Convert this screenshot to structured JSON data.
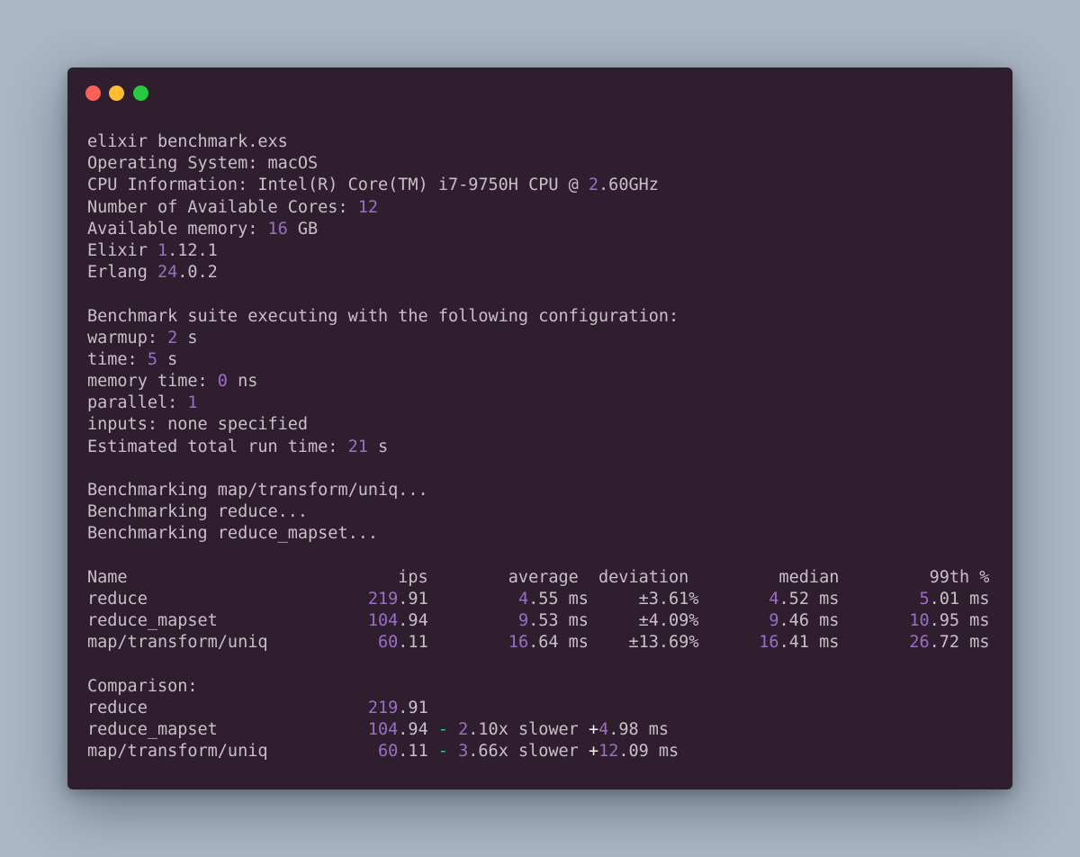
{
  "window": {
    "controls": [
      "close",
      "minimize",
      "zoom"
    ]
  },
  "colors": {
    "background": "#a9b6c3",
    "terminal_bg": "#2e1e2e",
    "text": "#c9bfc9",
    "number": "#9b6fc6",
    "separator": "#33c481",
    "plus": "#f2f2f2"
  },
  "terminal": {
    "lines": [
      [
        {
          "t": "elixir benchmark.exs"
        }
      ],
      [
        {
          "t": "Operating System: macOS"
        }
      ],
      [
        {
          "t": "CPU Information: Intel(R) Core(TM) i7-9750H CPU @ "
        },
        {
          "t": "2",
          "c": "n"
        },
        {
          "t": ".60GHz"
        }
      ],
      [
        {
          "t": "Number of Available Cores: "
        },
        {
          "t": "12",
          "c": "n"
        }
      ],
      [
        {
          "t": "Available memory: "
        },
        {
          "t": "16",
          "c": "n"
        },
        {
          "t": " GB"
        }
      ],
      [
        {
          "t": "Elixir "
        },
        {
          "t": "1",
          "c": "n"
        },
        {
          "t": ".12.1"
        }
      ],
      [
        {
          "t": "Erlang "
        },
        {
          "t": "24",
          "c": "n"
        },
        {
          "t": ".0.2"
        }
      ],
      [],
      [
        {
          "t": "Benchmark suite executing with the following configuration:"
        }
      ],
      [
        {
          "t": "warmup: "
        },
        {
          "t": "2",
          "c": "n"
        },
        {
          "t": " s"
        }
      ],
      [
        {
          "t": "time: "
        },
        {
          "t": "5",
          "c": "n"
        },
        {
          "t": " s"
        }
      ],
      [
        {
          "t": "memory time: "
        },
        {
          "t": "0",
          "c": "n"
        },
        {
          "t": " ns"
        }
      ],
      [
        {
          "t": "parallel: "
        },
        {
          "t": "1",
          "c": "n"
        }
      ],
      [
        {
          "t": "inputs: none specified"
        }
      ],
      [
        {
          "t": "Estimated total run time: "
        },
        {
          "t": "21",
          "c": "n"
        },
        {
          "t": " s"
        }
      ],
      [],
      [
        {
          "t": "Benchmarking map/transform/uniq..."
        }
      ],
      [
        {
          "t": "Benchmarking reduce..."
        }
      ],
      [
        {
          "t": "Benchmarking reduce_mapset..."
        }
      ],
      [],
      [
        {
          "t": "Name                           ips        average  deviation         median         99th %"
        }
      ],
      [
        {
          "t": "reduce                      "
        },
        {
          "t": "219",
          "c": "n"
        },
        {
          "t": ".91         "
        },
        {
          "t": "4",
          "c": "n"
        },
        {
          "t": ".55 ms     ±3.61%       "
        },
        {
          "t": "4",
          "c": "n"
        },
        {
          "t": ".52 ms        "
        },
        {
          "t": "5",
          "c": "n"
        },
        {
          "t": ".01 ms"
        }
      ],
      [
        {
          "t": "reduce_mapset               "
        },
        {
          "t": "104",
          "c": "n"
        },
        {
          "t": ".94         "
        },
        {
          "t": "9",
          "c": "n"
        },
        {
          "t": ".53 ms     ±4.09%       "
        },
        {
          "t": "9",
          "c": "n"
        },
        {
          "t": ".46 ms       "
        },
        {
          "t": "10",
          "c": "n"
        },
        {
          "t": ".95 ms"
        }
      ],
      [
        {
          "t": "map/transform/uniq           "
        },
        {
          "t": "60",
          "c": "n"
        },
        {
          "t": ".11        "
        },
        {
          "t": "16",
          "c": "n"
        },
        {
          "t": ".64 ms    ±13.69%      "
        },
        {
          "t": "16",
          "c": "n"
        },
        {
          "t": ".41 ms       "
        },
        {
          "t": "26",
          "c": "n"
        },
        {
          "t": ".72 ms"
        }
      ],
      [],
      [
        {
          "t": "Comparison:"
        }
      ],
      [
        {
          "t": "reduce                      "
        },
        {
          "t": "219",
          "c": "n"
        },
        {
          "t": ".91"
        }
      ],
      [
        {
          "t": "reduce_mapset               "
        },
        {
          "t": "104",
          "c": "n"
        },
        {
          "t": ".94 "
        },
        {
          "t": "-",
          "c": "g"
        },
        {
          "t": " "
        },
        {
          "t": "2",
          "c": "n"
        },
        {
          "t": ".10x slower "
        },
        {
          "t": "+",
          "c": "w"
        },
        {
          "t": "4",
          "c": "n"
        },
        {
          "t": ".98 ms"
        }
      ],
      [
        {
          "t": "map/transform/uniq           "
        },
        {
          "t": "60",
          "c": "n"
        },
        {
          "t": ".11 "
        },
        {
          "t": "-",
          "c": "g"
        },
        {
          "t": " "
        },
        {
          "t": "3",
          "c": "n"
        },
        {
          "t": ".66x slower "
        },
        {
          "t": "+",
          "c": "w"
        },
        {
          "t": "12",
          "c": "n"
        },
        {
          "t": ".09 ms"
        }
      ]
    ]
  }
}
